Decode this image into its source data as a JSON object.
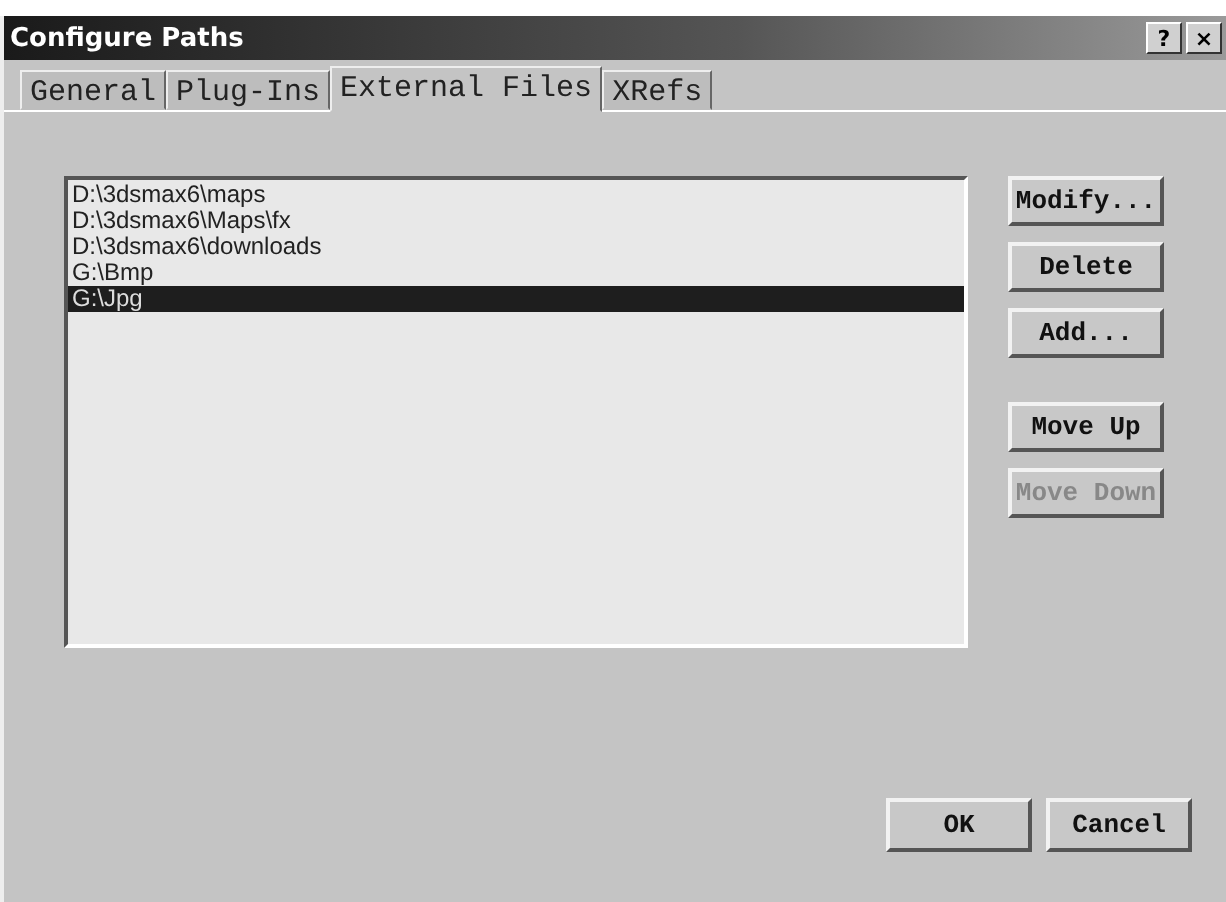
{
  "window": {
    "title": "Configure Paths",
    "title_buttons": [
      "?",
      "×"
    ]
  },
  "tabs": [
    {
      "label": "General",
      "selected": false
    },
    {
      "label": "Plug-Ins",
      "selected": false
    },
    {
      "label": "External Files",
      "selected": true
    },
    {
      "label": "XRefs",
      "selected": false
    }
  ],
  "paths": [
    {
      "text": "D:\\3dsmax6\\maps",
      "selected": false
    },
    {
      "text": "D:\\3dsmax6\\Maps\\fx",
      "selected": false
    },
    {
      "text": "D:\\3dsmax6\\downloads",
      "selected": false
    },
    {
      "text": "G:\\Bmp",
      "selected": false
    },
    {
      "text": "G:\\Jpg",
      "selected": true
    }
  ],
  "edit_buttons": [
    {
      "label": "Modify...",
      "disabled": false
    },
    {
      "label": "Delete",
      "disabled": false
    },
    {
      "label": "Add...",
      "disabled": false
    }
  ],
  "move_buttons": [
    {
      "label": "Move Up",
      "disabled": false
    },
    {
      "label": "Move Down",
      "disabled": true
    }
  ],
  "dialog_buttons": [
    "OK",
    "Cancel"
  ]
}
